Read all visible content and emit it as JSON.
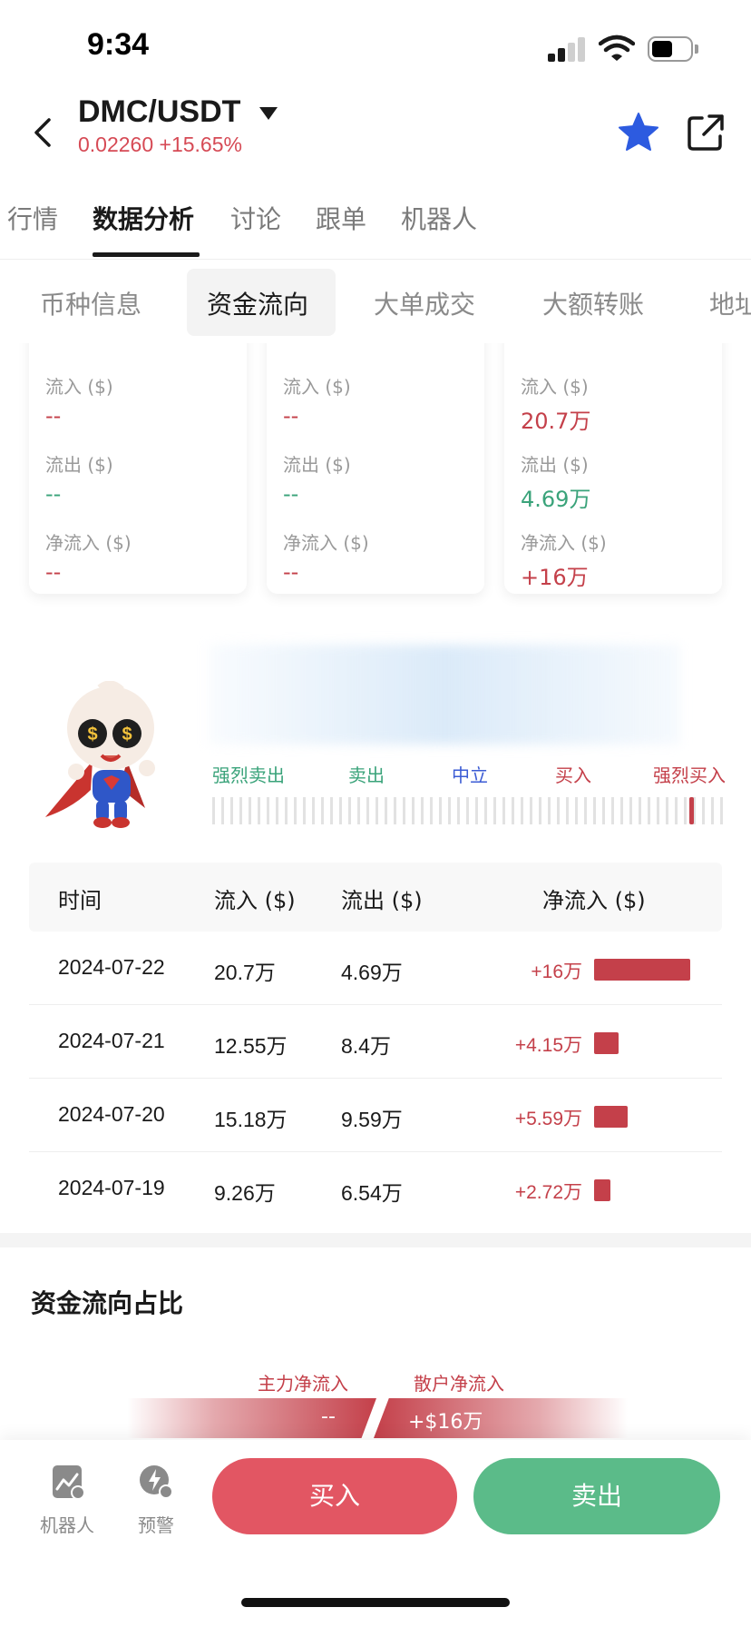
{
  "status_bar": {
    "time": "9:34"
  },
  "header": {
    "pair": "DMC/USDT",
    "price": "0.02260",
    "change": "+15.65%",
    "accent_color": "#2d5be0"
  },
  "main_tabs": [
    "行情",
    "数据分析",
    "讨论",
    "跟单",
    "机器人"
  ],
  "sub_tabs": [
    "币种信息",
    "资金流向",
    "大单成交",
    "大额转账",
    "地址"
  ],
  "cards": [
    {
      "inflow_label": "流入 ($)",
      "inflow": "--",
      "outflow_label": "流出 ($)",
      "outflow": "--",
      "net_label": "净流入 ($)",
      "net": "--"
    },
    {
      "inflow_label": "流入 ($)",
      "inflow": "--",
      "outflow_label": "流出 ($)",
      "outflow": "--",
      "net_label": "净流入 ($)",
      "net": "--"
    },
    {
      "inflow_label": "流入 ($)",
      "inflow": "20.7万",
      "outflow_label": "流出 ($)",
      "outflow": "4.69万",
      "net_label": "净流入 ($)",
      "net": "+16万"
    }
  ],
  "sentiment": {
    "labels": [
      "强烈卖出",
      "卖出",
      "中立",
      "买入",
      "强烈买入"
    ],
    "level": 0.93
  },
  "table": {
    "headers": [
      "时间",
      "流入 ($)",
      "流出 ($)",
      "净流入 ($)"
    ],
    "rows": [
      {
        "date": "2024-07-22",
        "inflow": "20.7万",
        "outflow": "4.69万",
        "net": "+16万",
        "net_value": 16
      },
      {
        "date": "2024-07-21",
        "inflow": "12.55万",
        "outflow": "8.4万",
        "net": "+4.15万",
        "net_value": 4.15
      },
      {
        "date": "2024-07-20",
        "inflow": "15.18万",
        "outflow": "9.59万",
        "net": "+5.59万",
        "net_value": 5.59
      },
      {
        "date": "2024-07-19",
        "inflow": "9.26万",
        "outflow": "6.54万",
        "net": "+2.72万",
        "net_value": 2.72
      }
    ]
  },
  "proportion": {
    "title": "资金流向占比",
    "main_label": "主力净流入",
    "main_value": "--",
    "retail_label": "散户净流入",
    "retail_value": "+$16万"
  },
  "bottom_bar": {
    "robot_label": "机器人",
    "alert_label": "预警",
    "buy_label": "买入",
    "sell_label": "卖出",
    "buy_color": "#e25663",
    "sell_color": "#5bbb89"
  }
}
